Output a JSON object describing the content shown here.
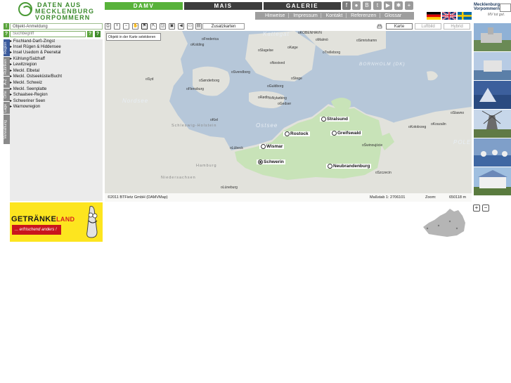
{
  "logo": {
    "line1": "DATEN AUS",
    "line2": "MECKLENBURG",
    "line3": "VORPOMMERN"
  },
  "nav": {
    "tabs": [
      {
        "label": "DAMV",
        "active": true
      },
      {
        "label": "MAIS",
        "active": false
      },
      {
        "label": "GALERIE",
        "active": false
      }
    ]
  },
  "social_icons": [
    "facebook-icon",
    "flickr-icon",
    "blogger-icon",
    "twitter-icon",
    "youtube-icon",
    "network-icon",
    "plus-icon"
  ],
  "subnav": [
    "Hinweise",
    "Impressum",
    "Kontakt",
    "Referenzen",
    "Glossar"
  ],
  "flags": [
    "flag-germany-icon",
    "flag-uk-icon",
    "flag-sweden-icon"
  ],
  "brand": {
    "line1": "Mecklenburg",
    "line2": "Vorpommern",
    "tagline": "MV tut gut."
  },
  "left": {
    "login_label": "Objekt-Anmeldung",
    "search_placeholder": "Suchbegriff",
    "vertical_tabs": [
      "Region",
      "Rubriken",
      "A-Z",
      "Orte",
      "Lage",
      "Verwaltung"
    ],
    "regions": [
      "Fischland-Darß-Zingst",
      "Insel Rügen & Hiddensee",
      "Insel Usedom & Peenetal",
      "Kühlung/Salzhaff",
      "Lewitzregion",
      "Meckl. Elbetal",
      "Meckl. Ostseeküste/Bucht",
      "Meckl. Schweiz",
      "Meckl. Seenplatte",
      "Schaalsee-Region",
      "Schweriner Seen",
      "Warnowregion"
    ]
  },
  "ad": {
    "brand_a": "GETRÄNKE",
    "brand_b": "LAND",
    "slogan": "... erfrischend anders !"
  },
  "map": {
    "zusatzkarten_label": "Zusatzkarten",
    "tooltip": "Objekt in der Karte selektieren",
    "modes": [
      {
        "label": "Karte",
        "active": true
      },
      {
        "label": "Luftbild",
        "active": false
      },
      {
        "label": "Hybrid",
        "active": false
      }
    ],
    "seas": [
      "Kattegat",
      "Nordsee",
      "Ostsee",
      "BORNHOLM (DK)",
      "POLE"
    ],
    "regions_faint": [
      "Schleswig-Holstein",
      "Hamburg",
      "Niedersachsen"
    ],
    "major_cities": [
      "Stralsund",
      "Rostock",
      "Greifswald",
      "Wismar",
      "Schwerin",
      "Neubrandenburg"
    ],
    "minor_cities": [
      "KOBENHAVN",
      "Malmö",
      "Simrishamn",
      "Frederica",
      "Kolding",
      "Slagelse",
      "Køge",
      "Trelleborg",
      "Nestved",
      "Svendborg",
      "Sønderborg",
      "Syd",
      "Stege",
      "Guldborg",
      "Flensburg",
      "Rødby",
      "Nykøbing",
      "Gedser",
      "Kiel",
      "Lübeck",
      "Lüneburg",
      "Kołobrzeg",
      "Koszalin",
      "Slawno",
      "Świnoujście",
      "Szczecin"
    ],
    "copyright": "©2011 BTFietz GmbH (DAMVMap)",
    "scale_label": "Maßstab 1: 2706101",
    "zoom_label": "Zoom:",
    "zoom_value": "650118 m"
  }
}
